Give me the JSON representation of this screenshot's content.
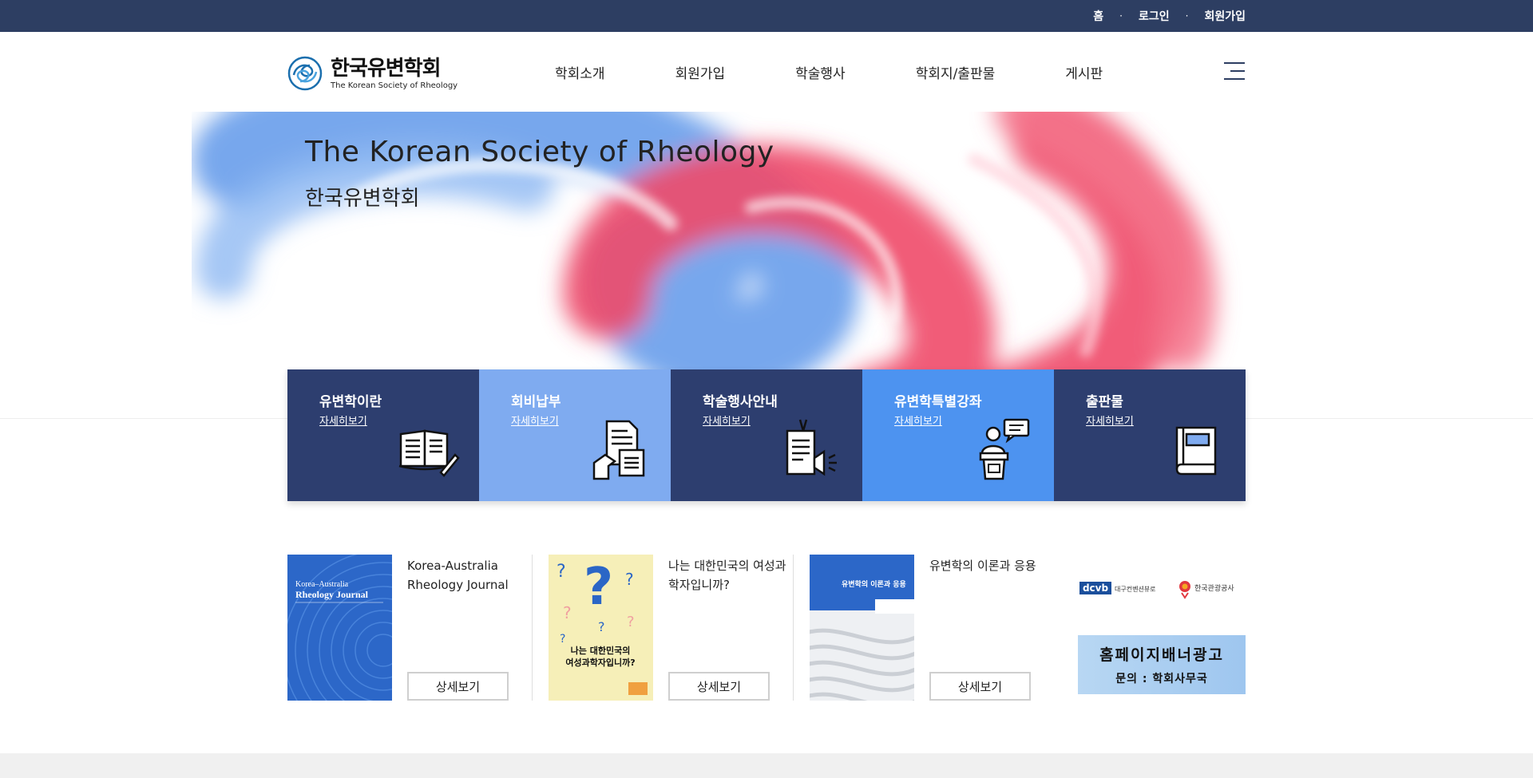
{
  "topbar": {
    "links": [
      "홈",
      "로그인",
      "회원가입"
    ]
  },
  "header": {
    "logo_ko": "한국유변학회",
    "logo_en": "The Korean Society of Rheology",
    "nav": [
      "학회소개",
      "회원가입",
      "학술행사",
      "학회지/출판물",
      "게시판"
    ]
  },
  "hero": {
    "title": "The Korean Society of Rheology",
    "subtitle": "한국유변학회"
  },
  "quick": [
    {
      "title": "유변학이란",
      "link": "자세히보기",
      "icon": "open-book-icon"
    },
    {
      "title": "회비납부",
      "link": "자세히보기",
      "icon": "document-hand-icon"
    },
    {
      "title": "학술행사안내",
      "link": "자세히보기",
      "icon": "megaphone-notice-icon"
    },
    {
      "title": "유변학특별강좌",
      "link": "자세히보기",
      "icon": "lecturer-podium-icon"
    },
    {
      "title": "출판물",
      "link": "자세히보기",
      "icon": "book-icon"
    }
  ],
  "pubs": [
    {
      "title": "Korea-Australia Rheology Journal",
      "button": "상세보기",
      "cover_text": "Korea–Australia Rheology Journal"
    },
    {
      "title": "나는 대한민국의 여성과학자입니까?",
      "button": "상세보기",
      "cover_text": "나는 대한민국의 여성과학자입니까?"
    },
    {
      "title": "유변학의 이론과 응용",
      "button": "상세보기",
      "cover_text": "유변학의 이론과 응용"
    }
  ],
  "banners": {
    "partner1": "dcvb",
    "partner1_sub": "대구컨벤션뷰로",
    "partner2": "한국관광공사",
    "ad_line1": "홈페이지배너광고",
    "ad_line2": "문의 : 학회사무국"
  },
  "colors": {
    "navy": "#2d3e62",
    "quick_dark": "#2d3e6f",
    "quick_light": "#7fabf0",
    "quick_mid": "#4d93f0"
  }
}
